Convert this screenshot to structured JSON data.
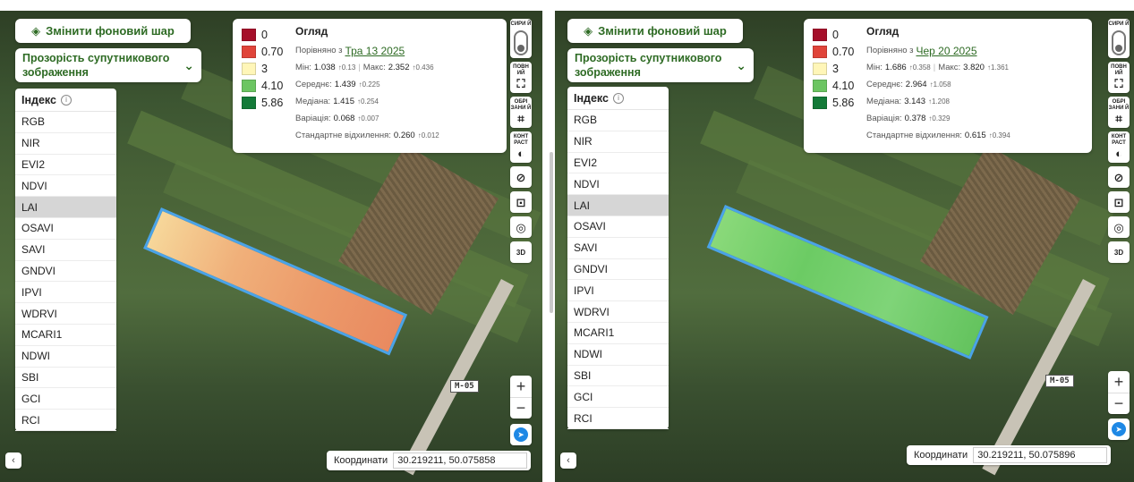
{
  "panels": [
    {
      "change_layer_label": "Змінити фоновий шар",
      "opacity_label": "Прозорість супутникового зображення",
      "index_header": "Індекс",
      "index_items": [
        "RGB",
        "NIR",
        "EVI2",
        "NDVI",
        "LAI",
        "OSAVI",
        "SAVI",
        "GNDVI",
        "IPVI",
        "WDRVI",
        "MCARI1",
        "NDWI",
        "SBI",
        "GCI",
        "RCI"
      ],
      "selected_index": "LAI",
      "legend": [
        {
          "value": "0",
          "color": "#a50f2a"
        },
        {
          "value": "0.70",
          "color": "#e0443a"
        },
        {
          "value": "3",
          "color": "#fff6b8"
        },
        {
          "value": "4.10",
          "color": "#6cc562"
        },
        {
          "value": "5.86",
          "color": "#137a38"
        }
      ],
      "overview": {
        "title": "Огляд",
        "compared_prefix": "Порівняно з",
        "compared_date": "Тра 13 2025",
        "min_label": "Мін:",
        "min_value": "1.038",
        "min_delta": "↑0.13",
        "max_label": "Макс:",
        "max_value": "2.352",
        "max_delta": "↑0.436",
        "mean_label": "Середнє:",
        "mean_value": "1.439",
        "mean_delta": "↑0.225",
        "median_label": "Медіана:",
        "median_value": "1.415",
        "median_delta": "↑0.254",
        "var_label": "Варіація:",
        "var_value": "0.068",
        "var_delta": "↑0.007",
        "std_label": "Стандартне відхилення:",
        "std_value": "0.260",
        "std_delta": "↑0.012"
      },
      "tools": {
        "raw": "СИРИ Й",
        "full": "ПОВН ИЙ",
        "crop": "ОБРІ ЗАНИ Й",
        "contrast": "КОНТ РАСТ",
        "threed": "3D"
      },
      "road_sign": "M-05",
      "coords_label": "Координати",
      "coords_value": "30.219211, 50.075858",
      "field_color": "#f0b27a"
    },
    {
      "change_layer_label": "Змінити фоновий шар",
      "opacity_label": "Прозорість супутникового зображення",
      "index_header": "Індекс",
      "index_items": [
        "RGB",
        "NIR",
        "EVI2",
        "NDVI",
        "LAI",
        "OSAVI",
        "SAVI",
        "GNDVI",
        "IPVI",
        "WDRVI",
        "MCARI1",
        "NDWI",
        "SBI",
        "GCI",
        "RCI"
      ],
      "selected_index": "LAI",
      "legend": [
        {
          "value": "0",
          "color": "#a50f2a"
        },
        {
          "value": "0.70",
          "color": "#e0443a"
        },
        {
          "value": "3",
          "color": "#fff6b8"
        },
        {
          "value": "4.10",
          "color": "#6cc562"
        },
        {
          "value": "5.86",
          "color": "#137a38"
        }
      ],
      "overview": {
        "title": "Огляд",
        "compared_prefix": "Порівняно з",
        "compared_date": "Чер 20 2025",
        "min_label": "Мін:",
        "min_value": "1.686",
        "min_delta": "↑0.358",
        "max_label": "Макс:",
        "max_value": "3.820",
        "max_delta": "↑1.361",
        "mean_label": "Середнє:",
        "mean_value": "2.964",
        "mean_delta": "↑1.058",
        "median_label": "Медіана:",
        "median_value": "3.143",
        "median_delta": "↑1.208",
        "var_label": "Варіація:",
        "var_value": "0.378",
        "var_delta": "↑0.329",
        "std_label": "Стандартне відхилення:",
        "std_value": "0.615",
        "std_delta": "↑0.394"
      },
      "tools": {
        "raw": "СИРИ Й",
        "full": "ПОВН ИЙ",
        "crop": "ОБРІ ЗАНИ Й",
        "contrast": "КОНТ РАСТ",
        "threed": "3D"
      },
      "road_sign": "M-05",
      "coords_label": "Координати",
      "coords_value": "30.219211, 50.075896",
      "field_color": "#7fd26a"
    }
  ]
}
